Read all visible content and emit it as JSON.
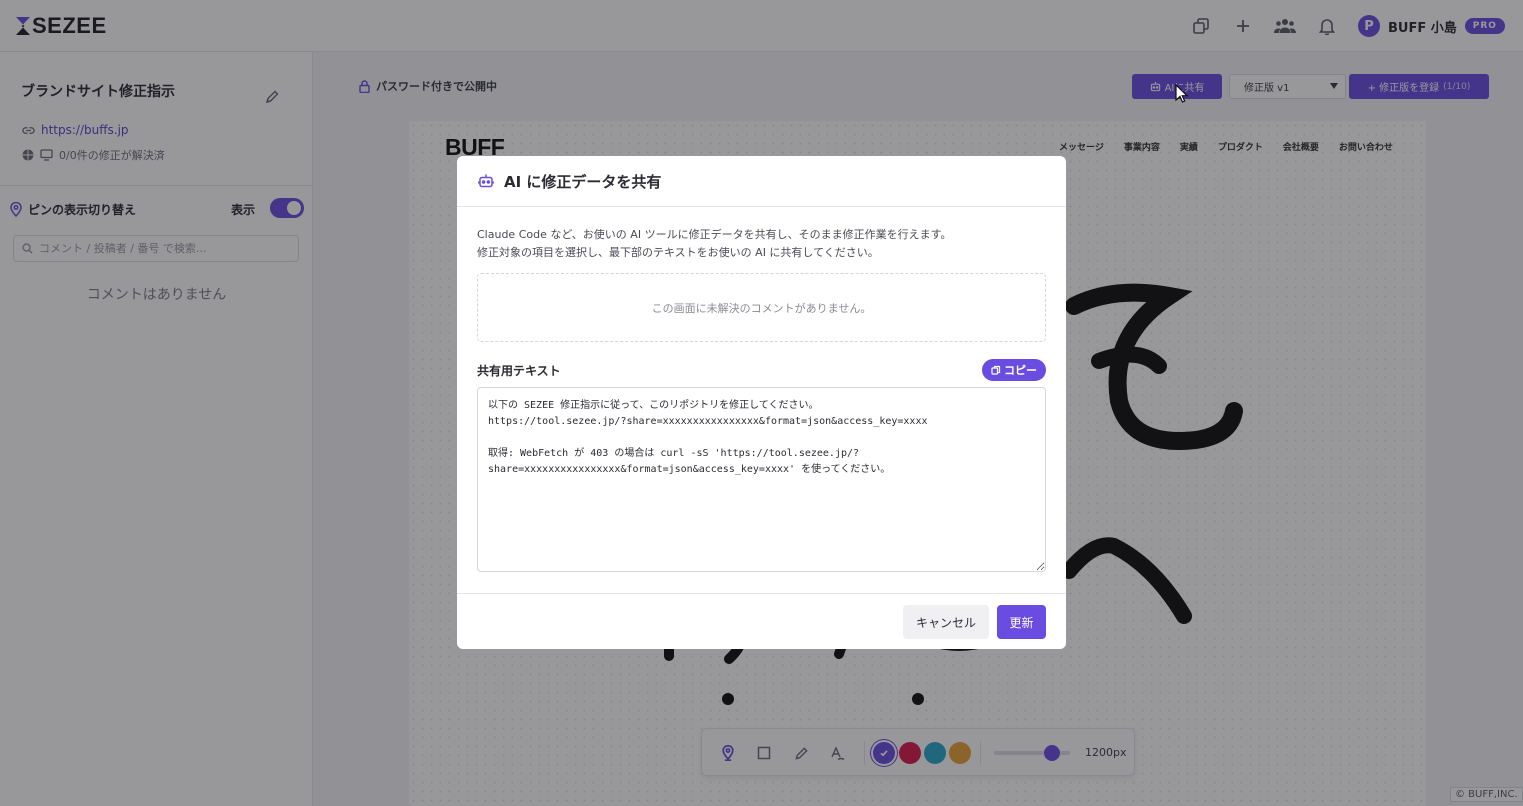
{
  "header": {
    "logo": "SEZEE",
    "icons": [
      "duplicate-icon",
      "plus-icon",
      "team-icon",
      "bell-icon"
    ],
    "user_initial": "P",
    "user_name": "BUFF 小島",
    "plan_badge": "PRO"
  },
  "sidebar": {
    "project_title": "ブランドサイト修正指示",
    "url": "https://buffs.jp",
    "resolved_status": "0/0件の修正が解決済",
    "pin_toggle_label": "ピンの表示切り替え",
    "show_label": "表示",
    "search_placeholder": "コメント / 投稿者 / 番号 で検索...",
    "empty_message": "コメントはありません"
  },
  "main": {
    "password_status": "パスワード付きで公開中",
    "ai_share_button": "AIに共有",
    "version_select": "修正版 v1",
    "register_button": "+ 修正版を登録",
    "register_count": "(1/10)"
  },
  "preview": {
    "site_logo": "BUFF",
    "nav": [
      "メッセージ",
      "事業内容",
      "実績",
      "プロダクト",
      "会社概要",
      "お問い合わせ"
    ]
  },
  "draw_toolbar": {
    "tools": [
      "pin-tool-icon",
      "rectangle-tool-icon",
      "pen-tool-icon",
      "text-tool-icon"
    ],
    "colors": [
      "#6a4de0",
      "#d81b4a",
      "#29a8c9",
      "#e8a23a"
    ],
    "selected_color_index": 0,
    "width_label": "1200px"
  },
  "copyright": "© BUFF,INC.",
  "modal": {
    "title": "AI に修正データを共有",
    "description_line1": "Claude Code など、お使いの AI ツールに修正データを共有し、そのまま修正作業を行えます。",
    "description_line2": "修正対象の項目を選択し、最下部のテキストをお使いの AI に共有してください。",
    "empty_message": "この画面に未解決のコメントがありません。",
    "share_label": "共有用テキスト",
    "copy_button": "コピー",
    "share_text": "以下の SEZEE 修正指示に従って、このリポジトリを修正してください。\nhttps://tool.sezee.jp/?share=xxxxxxxxxxxxxxxx&format=json&access_key=xxxx\n\n取得: WebFetch が 403 の場合は curl -sS 'https://tool.sezee.jp/?share=xxxxxxxxxxxxxxxx&format=json&access_key=xxxx' を使ってください。",
    "cancel_button": "キャンセル",
    "update_button": "更新"
  },
  "colors": {
    "accent": "#6a4de0",
    "overlay": "rgba(20,20,28,0.44)"
  }
}
